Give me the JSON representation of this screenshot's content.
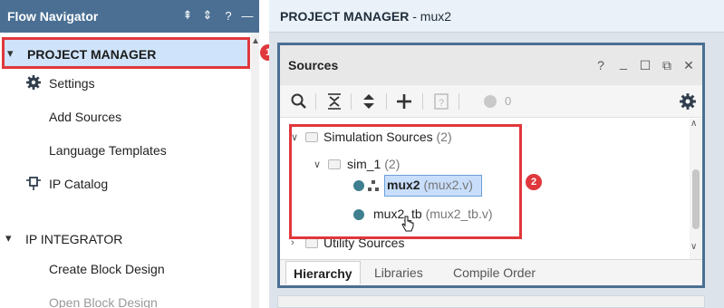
{
  "flow_navigator": {
    "title": "Flow Navigator",
    "header_icons": [
      "collapse-all-icon",
      "expand-collapse-icon",
      "help-icon",
      "minimize-icon"
    ],
    "header_glyphs": {
      "collapse": "⇞",
      "sort": "⇕",
      "help": "?",
      "minimize": "—"
    },
    "sections": [
      {
        "label": "PROJECT MANAGER",
        "expanded": true,
        "items": [
          {
            "label": "Settings",
            "icon": "gear-icon"
          },
          {
            "label": "Add Sources"
          },
          {
            "label": "Language Templates"
          },
          {
            "label": "IP Catalog",
            "icon": "ip-plug-icon"
          }
        ]
      },
      {
        "label": "IP INTEGRATOR",
        "expanded": true,
        "items": [
          {
            "label": "Create Block Design"
          },
          {
            "label": "Open Block Design",
            "disabled": true
          }
        ]
      }
    ]
  },
  "project_manager": {
    "title": "PROJECT MANAGER",
    "subtitle": " - mux2"
  },
  "sources_panel": {
    "title": "Sources",
    "window_glyphs": {
      "help": "?",
      "minimize": "_",
      "maximize": "☐",
      "float": "⧉",
      "close": "✕"
    },
    "toolbar": {
      "count": "0"
    },
    "tree": {
      "simulation_sources": {
        "label": "Simulation Sources",
        "count": "(2)"
      },
      "sim_1": {
        "label": "sim_1",
        "count": "(2)"
      },
      "mux2": {
        "label": "mux2",
        "file": "(mux2.v)"
      },
      "mux2_tb": {
        "label": "mux2_tb",
        "file": "(mux2_tb.v)"
      },
      "utility_sources": {
        "label": "Utility Sources"
      }
    },
    "tabs": [
      "Hierarchy",
      "Libraries",
      "Compile Order"
    ],
    "active_tab": "Hierarchy"
  },
  "annotations": {
    "badge_1": "1",
    "badge_2": "2"
  },
  "colors": {
    "header": "#4a6f93",
    "highlight": "#cfe3fa",
    "annotation_red": "#e0373c",
    "selection": "#c8defb",
    "source_dot": "#3f7f8f"
  }
}
